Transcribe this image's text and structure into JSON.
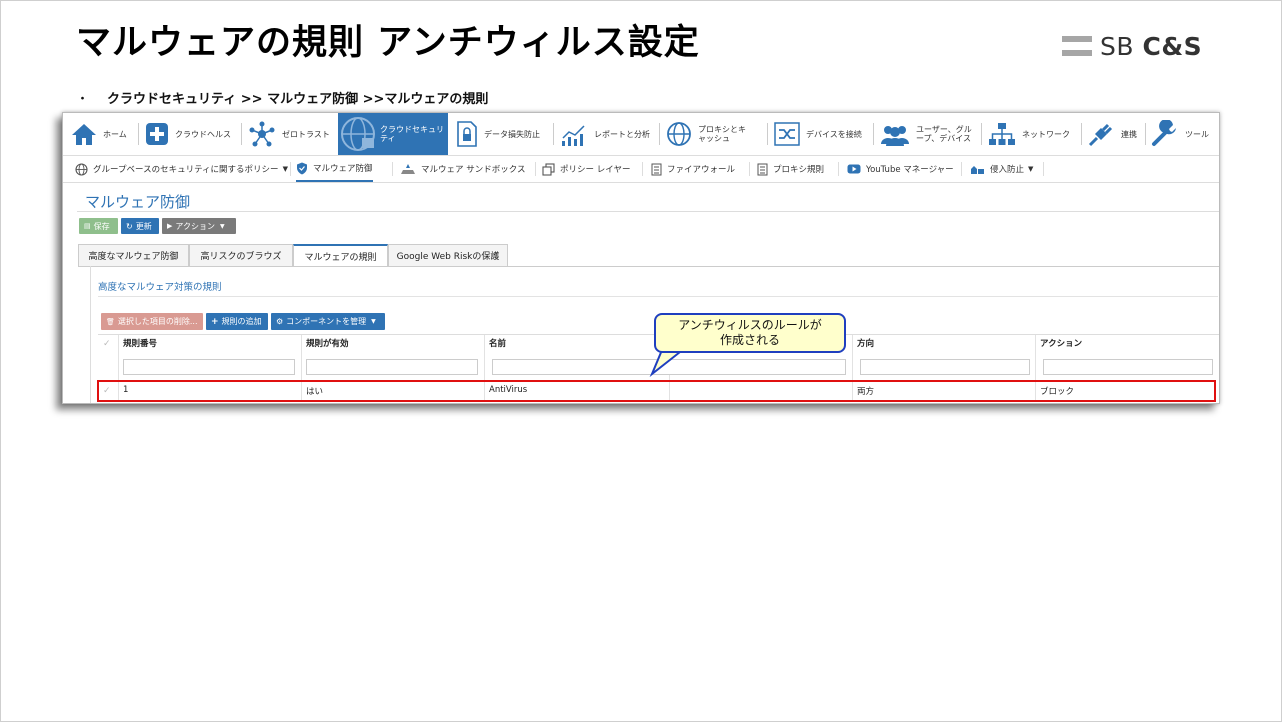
{
  "slide": {
    "title": "マルウェアの規則 アンチウィルス設定",
    "logo_sb": "SB",
    "logo_cs": "C&S",
    "breadcrumb_bullet": "・",
    "breadcrumb": "クラウドセキュリティ >> マルウェア防御 >>マルウェアの規則"
  },
  "topnav": [
    {
      "label": "ホーム",
      "icon": "home-icon"
    },
    {
      "label": "クラウドヘルス",
      "icon": "plus-icon"
    },
    {
      "label": "ゼロトラスト",
      "icon": "network-nodes-icon"
    },
    {
      "label": "クラウドセキュリティ",
      "icon": "globe-lock-icon",
      "active": true
    },
    {
      "label": "データ損失防止",
      "icon": "lock-document-icon"
    },
    {
      "label": "レポートと分析",
      "icon": "chart-icon"
    },
    {
      "label": "プロキシとキャッシュ",
      "icon": "globe-icon"
    },
    {
      "label": "デバイスを接続",
      "icon": "shuffle-icon"
    },
    {
      "label": "ユーザー、グループ、デバイス",
      "icon": "users-icon"
    },
    {
      "label": "ネットワーク",
      "icon": "network-tree-icon"
    },
    {
      "label": "連携",
      "icon": "plug-icon"
    },
    {
      "label": "ツール",
      "icon": "wrench-icon"
    }
  ],
  "subnav": [
    {
      "label": "グループベースのセキュリティに関するポリシー",
      "icon": "globe-icon",
      "dropdown": true
    },
    {
      "label": "マルウェア防御",
      "icon": "shield-icon",
      "active": true
    },
    {
      "label": "マルウェア サンドボックス",
      "icon": "sandbox-icon"
    },
    {
      "label": "ポリシー レイヤー",
      "icon": "layers-icon"
    },
    {
      "label": "ファイアウォール",
      "icon": "list-icon"
    },
    {
      "label": "プロキシ規則",
      "icon": "list-icon"
    },
    {
      "label": "YouTube マネージャー",
      "icon": "youtube-icon"
    },
    {
      "label": "侵入防止",
      "icon": "intrusion-icon",
      "dropdown": true
    }
  ],
  "page": {
    "title": "マルウェア防御",
    "toolbar": {
      "save": "保存",
      "refresh": "更新",
      "action": "アクション"
    },
    "tabs": [
      "高度なマルウェア防御",
      "高リスクのブラウズ",
      "マルウェアの規則",
      "Google Web Riskの保護"
    ],
    "active_tab": 2,
    "panel_title": "高度なマルウェア対策の規則",
    "grid_buttons": {
      "delete": "選択した項目の削除...",
      "add": "規則の追加",
      "components": "コンポーネントを管理"
    },
    "columns": [
      "規則番号",
      "規則が有効",
      "名前",
      "方向",
      "アクション"
    ],
    "rows": [
      {
        "number": "1",
        "enabled": "はい",
        "name": "AntiVirus",
        "direction": "両方",
        "action": "ブロック"
      }
    ]
  },
  "callout": {
    "line1": "アンチウィルスのルールが",
    "line2": "作成される"
  },
  "colors": {
    "accent": "#2f73b4",
    "highlight": "#e01010",
    "callout_border": "#1f3fbf",
    "callout_fill": "#ffffcc"
  }
}
